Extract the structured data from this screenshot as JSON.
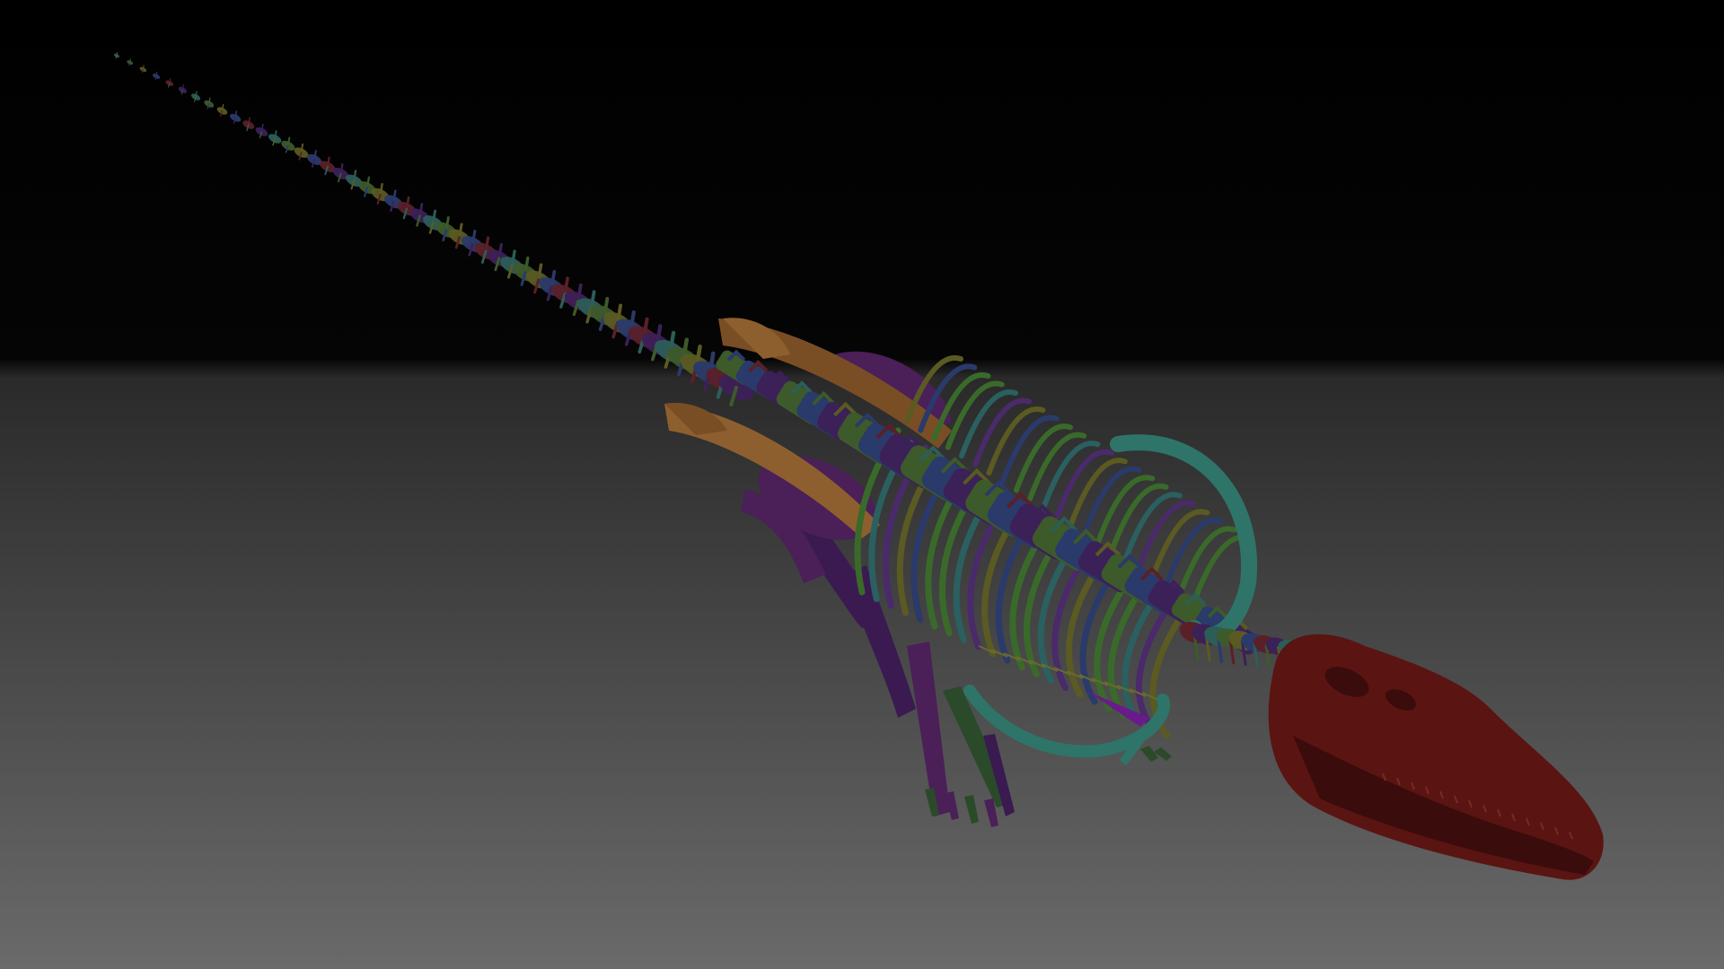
{
  "scene": {
    "subject": "skeleton",
    "background_colors": {
      "top": "#000000",
      "horizon": "#2a2a2a",
      "bottom": "#6a6a6a"
    },
    "bone_colors": {
      "skull": "#5a1412",
      "skull_dark": "#3a0c0b",
      "pelvis": "#7a4e24",
      "pelvis_light": "#8e5f2e",
      "scapula": "#2f7468",
      "purple": "#4b1f58",
      "vertebra_teal": "#2c5e58",
      "vertebra_green": "#3c5a2a",
      "vertebra_olive": "#5a5a22",
      "vertebra_blue": "#2a3a6a",
      "vertebra_red": "#5a2028",
      "vertebra_purple": "#3c2058",
      "rib_green": "#3a6a2a",
      "rib_teal": "#2a6060",
      "rib_purple": "#4a2a6a",
      "limb_purple": "#3a1a50",
      "limb_green": "#2a4a2a"
    }
  }
}
